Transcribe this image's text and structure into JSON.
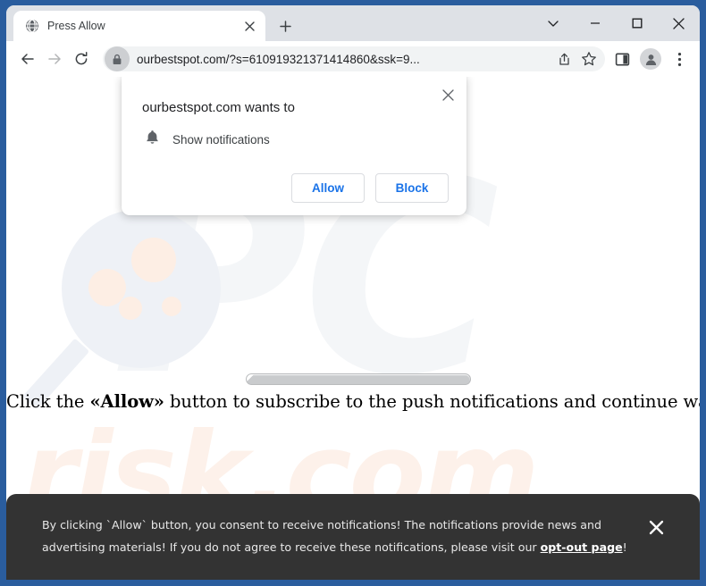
{
  "window": {
    "frame_color": "#2a5d9e",
    "controls": [
      {
        "name": "tab-search",
        "glyph": "chevron-down"
      },
      {
        "name": "minimize",
        "glyph": "minimize"
      },
      {
        "name": "maximize",
        "glyph": "maximize"
      },
      {
        "name": "close",
        "glyph": "close"
      }
    ]
  },
  "tab": {
    "title": "Press Allow",
    "favicon": "globe-icon",
    "close_label": "×",
    "new_tab_label": "+"
  },
  "toolbar": {
    "back": "←",
    "forward": "→",
    "reload": "⟳",
    "lock_icon": "lock-icon",
    "url": "ourbestspot.com/?s=610919321371414860&ssk=9...",
    "share_icon": "share-icon",
    "bookmark_icon": "star-icon",
    "side_panel_icon": "side-panel-icon",
    "profile_icon": "avatar-icon",
    "menu_icon": "three-dot-menu-icon"
  },
  "permission_dialog": {
    "title": "ourbestspot.com wants to",
    "permission_icon": "bell-icon",
    "permission_label": "Show notifications",
    "allow_label": "Allow",
    "block_label": "Block",
    "close_label": "×",
    "accent_color": "#1a73e8"
  },
  "page": {
    "headline_prefix": "Click the ",
    "headline_emphasis": "«Allow»",
    "headline_suffix": " button to subscribe to the push notifications and continue watching",
    "progress_bar": "striped-progress-bar",
    "watermark_primary": "PC",
    "watermark_secondary": "risk.com",
    "watermark_glass": "magnifier-icon"
  },
  "consent_banner": {
    "text_before_link": "By clicking `Allow` button, you consent to receive notifications! The notifications provide news and advertising materials! If you do not agree to receive these notifications, please visit our ",
    "link_label": "opt-out page",
    "text_after_link": "!",
    "close_label": "✕",
    "background_color": "#333333"
  }
}
